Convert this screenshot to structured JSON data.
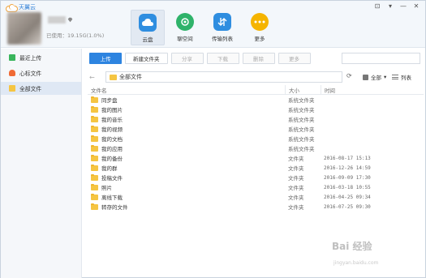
{
  "app": {
    "title": "天翼云"
  },
  "window_controls": [
    "⊡",
    "▾",
    "—",
    "✕"
  ],
  "user": {
    "usage_text": "已使用：19.15G(1.0%)"
  },
  "nav": [
    {
      "label": "云盘",
      "icon": "cloud-disk-icon"
    },
    {
      "label": "聊空间",
      "icon": "share-space-icon"
    },
    {
      "label": "传输列表",
      "icon": "transfer-icon"
    },
    {
      "label": "更多",
      "icon": "more-icon"
    }
  ],
  "sidebar": {
    "items": [
      {
        "label": "最近上传",
        "icon": "upload-icon"
      },
      {
        "label": "心标文件",
        "icon": "heart-icon"
      },
      {
        "label": "全部文件",
        "icon": "folder-icon"
      }
    ]
  },
  "toolbar": {
    "upload": "上传",
    "new_folder": "新建文件夹",
    "share": "分享",
    "download": "下载",
    "delete": "删除",
    "more": "更多"
  },
  "path": {
    "back": "←",
    "current": "全部文件",
    "view_all": "全部",
    "view_list": "列表"
  },
  "table": {
    "headers": {
      "name": "文件名",
      "size": "大小",
      "time": "时间"
    },
    "rows": [
      {
        "name": "同步盘",
        "size": "系统文件夹",
        "time": ""
      },
      {
        "name": "我的图片",
        "size": "系统文件夹",
        "time": ""
      },
      {
        "name": "我的音乐",
        "size": "系统文件夹",
        "time": ""
      },
      {
        "name": "我的视频",
        "size": "系统文件夹",
        "time": ""
      },
      {
        "name": "我的文档",
        "size": "系统文件夹",
        "time": ""
      },
      {
        "name": "我的应用",
        "size": "系统文件夹",
        "time": ""
      },
      {
        "name": "我的备份",
        "size": "文件夹",
        "time": "2016-08-17 15:13"
      },
      {
        "name": "我的群",
        "size": "文件夹",
        "time": "2016-12-26 14:59"
      },
      {
        "name": "投稿文件",
        "size": "文件夹",
        "time": "2016-09-09 17:30"
      },
      {
        "name": "照片",
        "size": "文件夹",
        "time": "2016-03-18 10:55"
      },
      {
        "name": "离线下载",
        "size": "文件夹",
        "time": "2016-04-25 09:34"
      },
      {
        "name": "转存的文件",
        "size": "文件夹",
        "time": "2016-07-25 09:30"
      }
    ]
  },
  "watermark": {
    "text": "Bai 经验",
    "sub": "jingyan.baidu.com"
  },
  "colors": {
    "accent": "#2d84e0",
    "folder": "#f5c542"
  }
}
